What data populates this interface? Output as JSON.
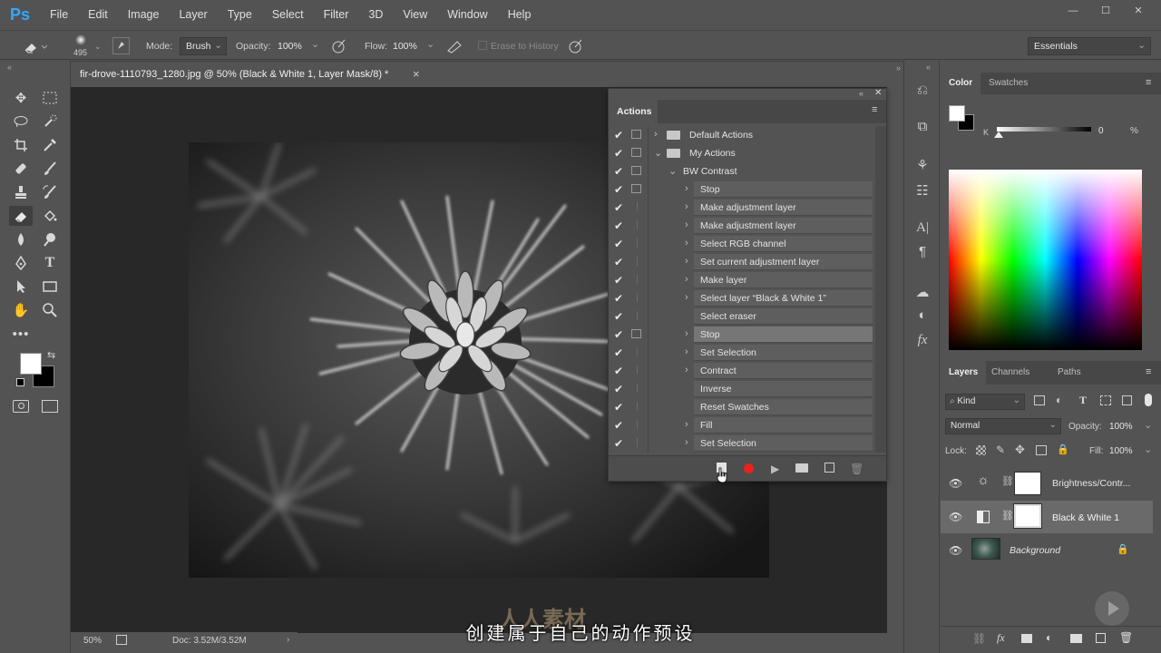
{
  "app": {
    "logo": "Ps"
  },
  "menu": [
    "File",
    "Edit",
    "Image",
    "Layer",
    "Type",
    "Select",
    "Filter",
    "3D",
    "View",
    "Window",
    "Help"
  ],
  "window_controls": [
    "—",
    "☐",
    "✕"
  ],
  "options_bar": {
    "brush_size": "495",
    "mode_label": "Mode:",
    "mode_value": "Brush",
    "opacity_label": "Opacity:",
    "opacity_value": "100%",
    "flow_label": "Flow:",
    "flow_value": "100%",
    "erase_history_label": "Erase to History",
    "workspace": "Essentials"
  },
  "document": {
    "tab_title": "fir-drove-1110793_1280.jpg @ 50% (Black & White 1, Layer Mask/8) *",
    "close": "×",
    "zoom": "50%",
    "doc_size": "Doc: 3.52M/3.52M"
  },
  "actions_panel": {
    "title": "Actions",
    "rows": [
      {
        "label": "Default Actions",
        "level": 0,
        "type": "set",
        "expanded": false,
        "has_dialog": true
      },
      {
        "label": "My Actions",
        "level": 0,
        "type": "set",
        "expanded": true,
        "has_dialog": true
      },
      {
        "label": "BW Contrast",
        "level": 1,
        "type": "action",
        "expanded": true,
        "has_dialog": true
      },
      {
        "label": "Stop",
        "level": 2,
        "has_dialog": true,
        "caret": true
      },
      {
        "label": "Make adjustment layer",
        "level": 2,
        "has_dialog": false,
        "caret": true
      },
      {
        "label": "Make adjustment layer",
        "level": 2,
        "has_dialog": false,
        "caret": true
      },
      {
        "label": "Select RGB channel",
        "level": 2,
        "has_dialog": false,
        "caret": true
      },
      {
        "label": "Set current adjustment layer",
        "level": 2,
        "has_dialog": false,
        "caret": true
      },
      {
        "label": "Make layer",
        "level": 2,
        "has_dialog": false,
        "caret": true
      },
      {
        "label": "Select layer “Black & White 1”",
        "level": 2,
        "has_dialog": false,
        "caret": true
      },
      {
        "label": "Select eraser",
        "level": 2,
        "has_dialog": false,
        "caret": false
      },
      {
        "label": "Stop",
        "level": 2,
        "has_dialog": true,
        "caret": true,
        "selected": true
      },
      {
        "label": "Set Selection",
        "level": 2,
        "has_dialog": false,
        "caret": true
      },
      {
        "label": "Contract",
        "level": 2,
        "has_dialog": false,
        "caret": true
      },
      {
        "label": "Inverse",
        "level": 2,
        "has_dialog": false,
        "caret": false
      },
      {
        "label": "Reset Swatches",
        "level": 2,
        "has_dialog": false,
        "caret": false
      },
      {
        "label": "Fill",
        "level": 2,
        "has_dialog": false,
        "caret": true
      },
      {
        "label": "Set Selection",
        "level": 2,
        "has_dialog": false,
        "caret": true
      }
    ]
  },
  "color_panel": {
    "tabs": [
      "Color",
      "Swatches"
    ],
    "channel_label": "K",
    "channel_value": "0",
    "channel_unit": "%"
  },
  "layers_panel": {
    "tabs": [
      "Layers",
      "Channels",
      "Paths"
    ],
    "filter_kind": "Kind",
    "blend_mode": "Normal",
    "opacity_label": "Opacity:",
    "opacity_value": "100%",
    "lock_label": "Lock:",
    "fill_label": "Fill:",
    "fill_value": "100%",
    "layers": [
      {
        "name": "Brightness/Contr...",
        "type": "adjustment-brightness"
      },
      {
        "name": "Black & White 1",
        "type": "adjustment-bw",
        "selected": true
      },
      {
        "name": "Background",
        "type": "image",
        "locked": true
      }
    ]
  },
  "overlay": {
    "subtitle": "创建属于自己的动作预设",
    "watermark": "人人素材"
  },
  "colors": {
    "ps_blue": "#31a8ff",
    "record_red": "#e8231e"
  }
}
